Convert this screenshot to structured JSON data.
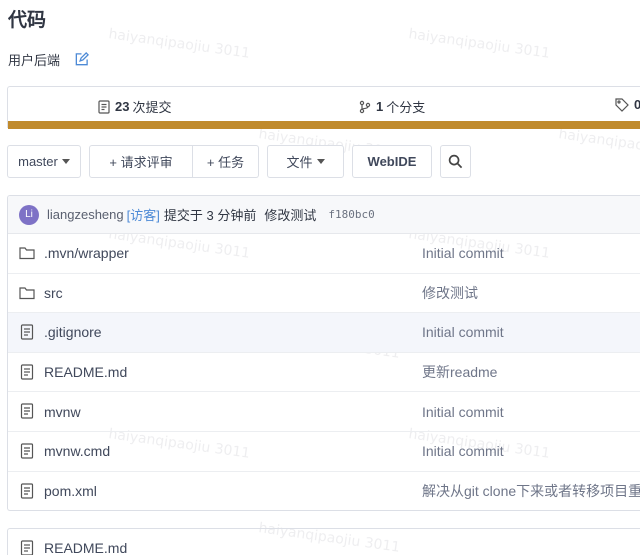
{
  "page": {
    "title": "代码"
  },
  "repo": {
    "description": "用户后端"
  },
  "stats": {
    "commits_count": "23",
    "commits_label": "次提交",
    "branches_count": "1",
    "branches_label": "个分支",
    "tags_count": "0"
  },
  "toolbar": {
    "branch": "master",
    "pull_request": "+ 请求评审",
    "task": "+ 任务",
    "file": "文件",
    "webide": "WebIDE"
  },
  "commit": {
    "avatar_initials": "Li",
    "author": "liangzesheng",
    "visitor_tag": "[访客]",
    "action": "提交于 3 分钟前",
    "message": "修改测试",
    "hash": "f180bc0"
  },
  "files": [
    {
      "type": "folder",
      "name": ".mvn/wrapper",
      "commit": "Initial commit"
    },
    {
      "type": "folder",
      "name": "src",
      "commit": "修改测试"
    },
    {
      "type": "file",
      "name": ".gitignore",
      "commit": "Initial commit"
    },
    {
      "type": "file",
      "name": "README.md",
      "commit": "更新readme"
    },
    {
      "type": "file",
      "name": "mvnw",
      "commit": "Initial commit"
    },
    {
      "type": "file",
      "name": "mvnw.cmd",
      "commit": "Initial commit"
    },
    {
      "type": "file",
      "name": "pom.xml",
      "commit": "解决从git clone下来或者转移项目重"
    }
  ],
  "readme": {
    "name": "README.md"
  },
  "watermark": {
    "text": "haiyanqipaojiu 3011"
  },
  "colors": {
    "accent_bar": "#c08a2c",
    "avatar": "#7e72c6",
    "link": "#4d8ad6"
  }
}
